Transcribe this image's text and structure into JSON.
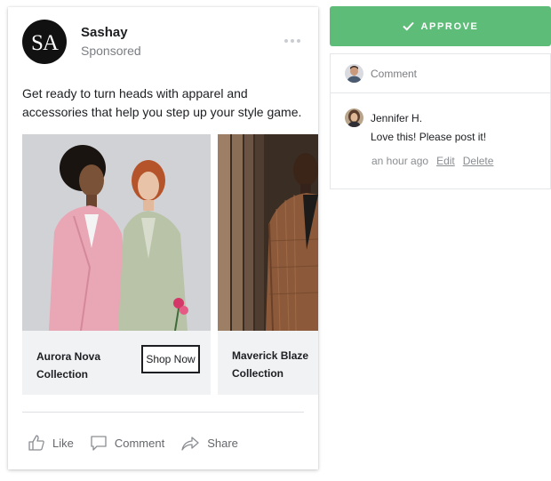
{
  "ad": {
    "brand_name": "Sashay",
    "logo_text": "SA",
    "sponsored_label": "Sponsored",
    "body_text": "Get ready to turn heads with apparel and accessories that help you step up your style game.",
    "slides": [
      {
        "title_line1": "Aurora Nova",
        "title_line2": "Collection",
        "cta": "Shop Now"
      },
      {
        "title_line1": "Maverick Blaze",
        "title_line2": "Collection"
      }
    ],
    "actions": {
      "like": "Like",
      "comment": "Comment",
      "share": "Share"
    }
  },
  "review": {
    "approve_label": "APPROVE",
    "comment_placeholder": "Comment",
    "comments": [
      {
        "author": "Jennifer H.",
        "text": "Love this! Please post it!",
        "time": "an hour ago",
        "edit": "Edit",
        "delete": "Delete"
      }
    ]
  },
  "colors": {
    "approve": "#5dbd78",
    "text": "#1c1e21",
    "muted": "#7a7d82"
  }
}
